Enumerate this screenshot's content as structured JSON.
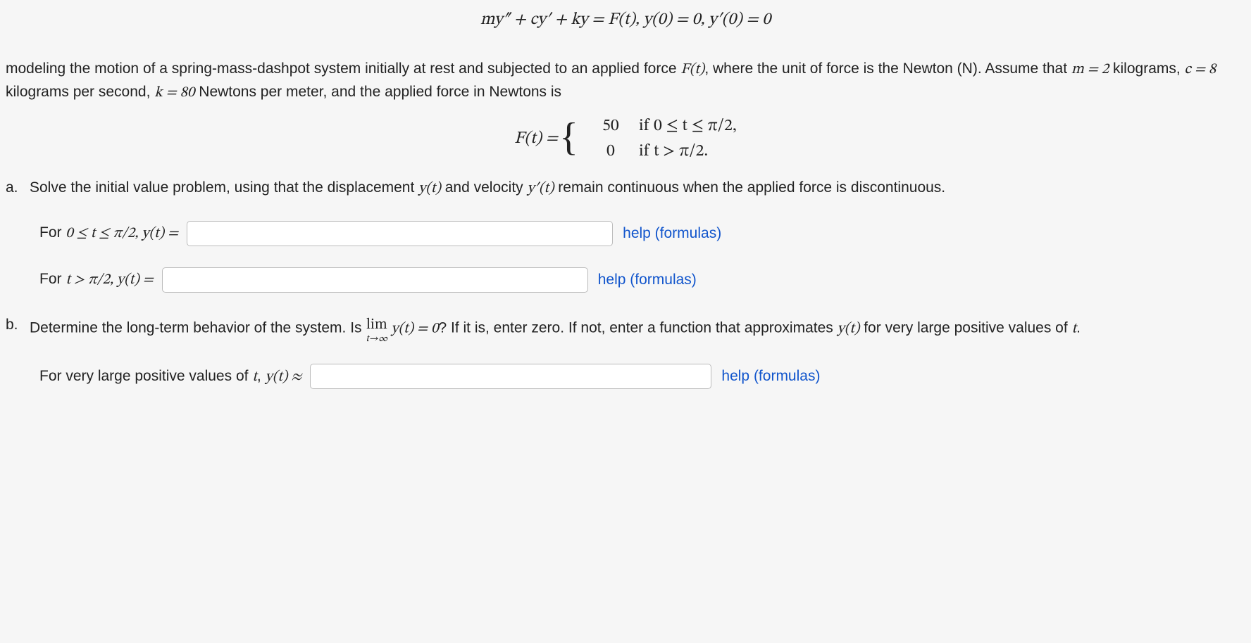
{
  "eq_top": "my″ + cy′ + ky = F(t),   y(0) = 0,   y′(0) = 0",
  "para1_a": "modeling the motion of a spring-mass-dashpot system initially at rest and subjected to an applied force ",
  "para1_b": "F(t)",
  "para1_c": ", where the unit of force is the Newton (N). Assume that ",
  "para1_d": "m = 2",
  "para1_e": " kilograms, ",
  "para1_f": "c = 8",
  "para1_g": " kilograms per second, ",
  "para1_h": "k = 80",
  "para1_i": " Newtons per meter, and the applied force in Newtons is",
  "Ft_label": "F(t) = ",
  "case1_val": "50",
  "case1_cond": "if 0 ≤ t ≤ π/2,",
  "case2_val": "0",
  "case2_cond": "if t > π/2.",
  "part_a_label": "a.",
  "part_a_text_1": "Solve the initial value problem, using that the displacement ",
  "part_a_yt": "y(t)",
  "part_a_text_2": " and velocity ",
  "part_a_ypt": "y′(t)",
  "part_a_text_3": " remain continuous when the applied force is discontinuous.",
  "row1_label_a": "For ",
  "row1_label_b": "0 ≤ t ≤ π/2,  y(t) = ",
  "row2_label_a": "For ",
  "row2_label_b": "t > π/2,  y(t) = ",
  "part_b_label": "b.",
  "part_b_text_1": "Determine the long-term behavior of the system. Is ",
  "part_b_lim_top": "lim",
  "part_b_lim_bot": "t→∞",
  "part_b_lim_after": " y(t) = 0",
  "part_b_text_2": "? If it is, enter zero. If not, enter a function that approximates ",
  "part_b_yt": "y(t)",
  "part_b_text_3": " for very large positive values of ",
  "part_b_t": "t",
  "part_b_text_4": ".",
  "row3_label_a": "For very large positive values of ",
  "row3_label_b": "t",
  "row3_label_c": ", ",
  "row3_label_d": "y(t) ≈ ",
  "help_text": "help (formulas)",
  "inputs": {
    "ans1": "",
    "ans2": "",
    "ans3": ""
  }
}
